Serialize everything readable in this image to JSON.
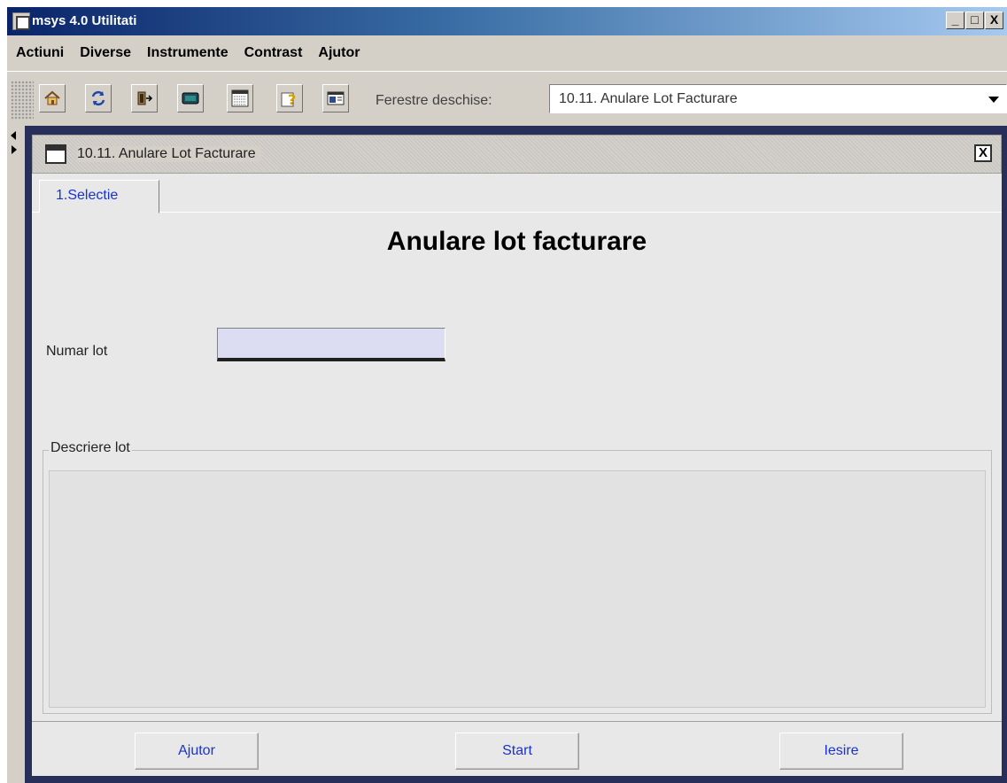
{
  "app": {
    "title": "msys 4.0 Utilitati"
  },
  "window_controls": {
    "minimize": "_",
    "maximize": "□",
    "close": "X"
  },
  "menu": [
    "Actiuni",
    "Diverse",
    "Instrumente",
    "Contrast",
    "Ajutor"
  ],
  "toolbar": {
    "icons": [
      "home-icon",
      "refresh-icon",
      "exit-icon",
      "monitor-icon",
      "calendar-icon",
      "help-icon",
      "window-icon"
    ],
    "ferestre_label": "Ferestre deschise:",
    "ferestre_value": "10.11. Anulare Lot Facturare"
  },
  "internal_frame": {
    "title": "10.11. Anulare Lot Facturare",
    "close_glyph": "X"
  },
  "tabs": [
    {
      "label": "1.Selectie"
    }
  ],
  "form": {
    "title": "Anulare lot facturare",
    "numar_lot_label": "Numar lot",
    "numar_lot_value": "",
    "descriere_label": "Descriere lot",
    "descriere_value": ""
  },
  "buttons": {
    "ajutor": "Ajutor",
    "start": "Start",
    "iesire": "Iesire"
  }
}
